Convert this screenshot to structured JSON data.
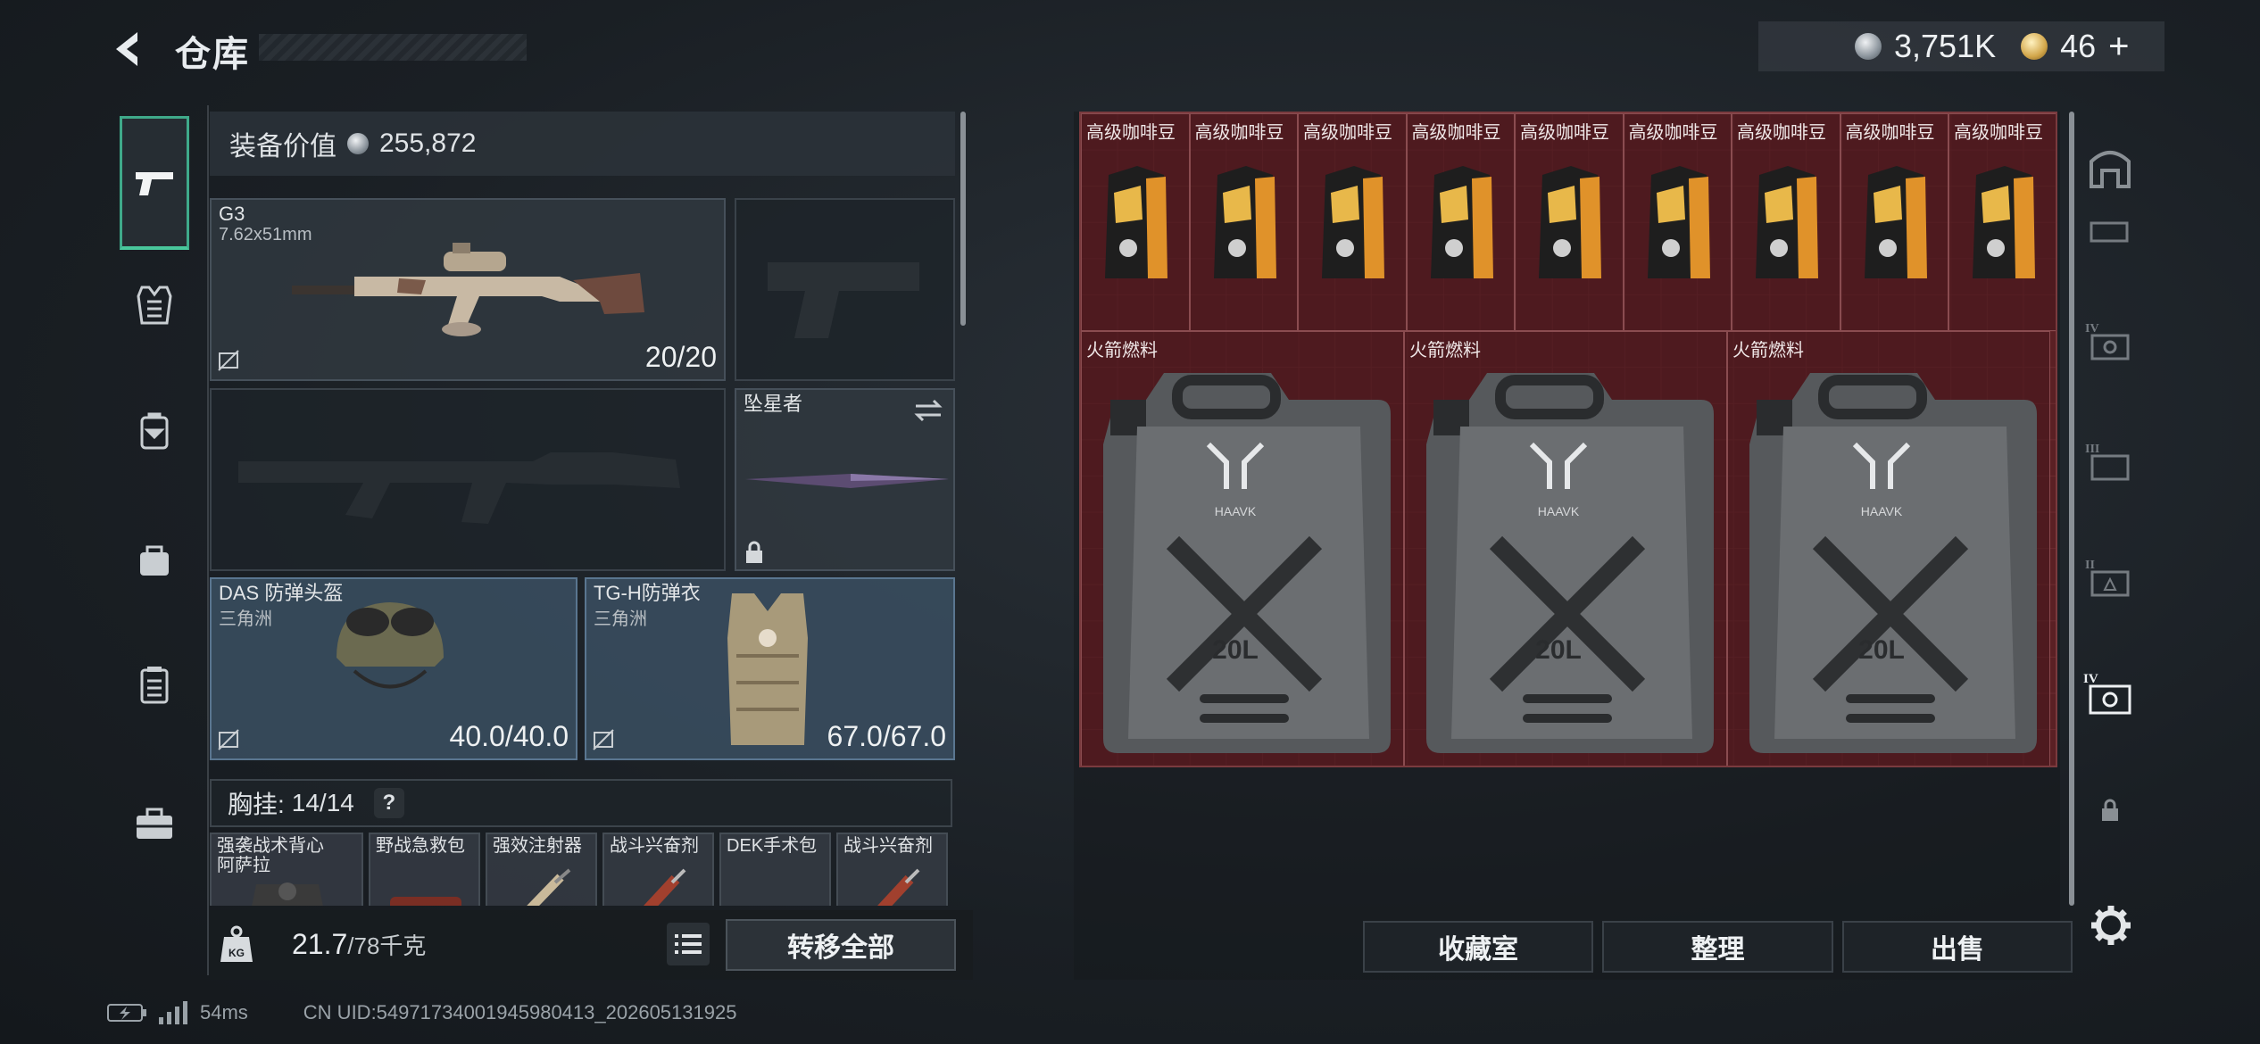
{
  "header": {
    "title": "仓库",
    "currency_silver": "3,751K",
    "currency_gold": "46",
    "add_label": "+"
  },
  "loadout": {
    "equip_value_label": "装备价值",
    "equip_value": "255,872",
    "primary": {
      "name": "G3",
      "caliber": "7.62x51mm",
      "durability": "20/20"
    },
    "melee": {
      "name": "坠星者"
    },
    "helmet": {
      "name": "DAS 防弹头盔",
      "faction": "三角洲",
      "durability": "40.0/40.0"
    },
    "armor": {
      "name": "TG-H防弹衣",
      "faction": "三角洲",
      "durability": "67.0/67.0"
    },
    "rig": {
      "label": "胸挂:",
      "capacity": "14/14",
      "help": "?",
      "items": [
        {
          "name": "强袭战术背心",
          "sub": "阿萨拉"
        },
        {
          "name": "野战急救包"
        },
        {
          "name": "强效注射器"
        },
        {
          "name": "战斗兴奋剂"
        },
        {
          "name": "DEK手术包"
        },
        {
          "name": "战斗兴奋剂"
        }
      ]
    }
  },
  "weight": {
    "current": "21.7",
    "max": "/78千克"
  },
  "buttons": {
    "transfer_all": "转移全部",
    "collection": "收藏室",
    "sort": "整理",
    "sell": "出售"
  },
  "stash": {
    "coffee_label": "高级咖啡豆",
    "coffee_count": 9,
    "fuel_label": "火箭燃料",
    "fuel_count": 3,
    "fuel_capacity": "20L",
    "fuel_brand": "HAAVK"
  },
  "status": {
    "ping": "54ms",
    "uid": "CN UID:54971734001945980413_202605131925"
  },
  "colors": {
    "accent": "#49c79c",
    "stash_bg": "#5a2024"
  }
}
